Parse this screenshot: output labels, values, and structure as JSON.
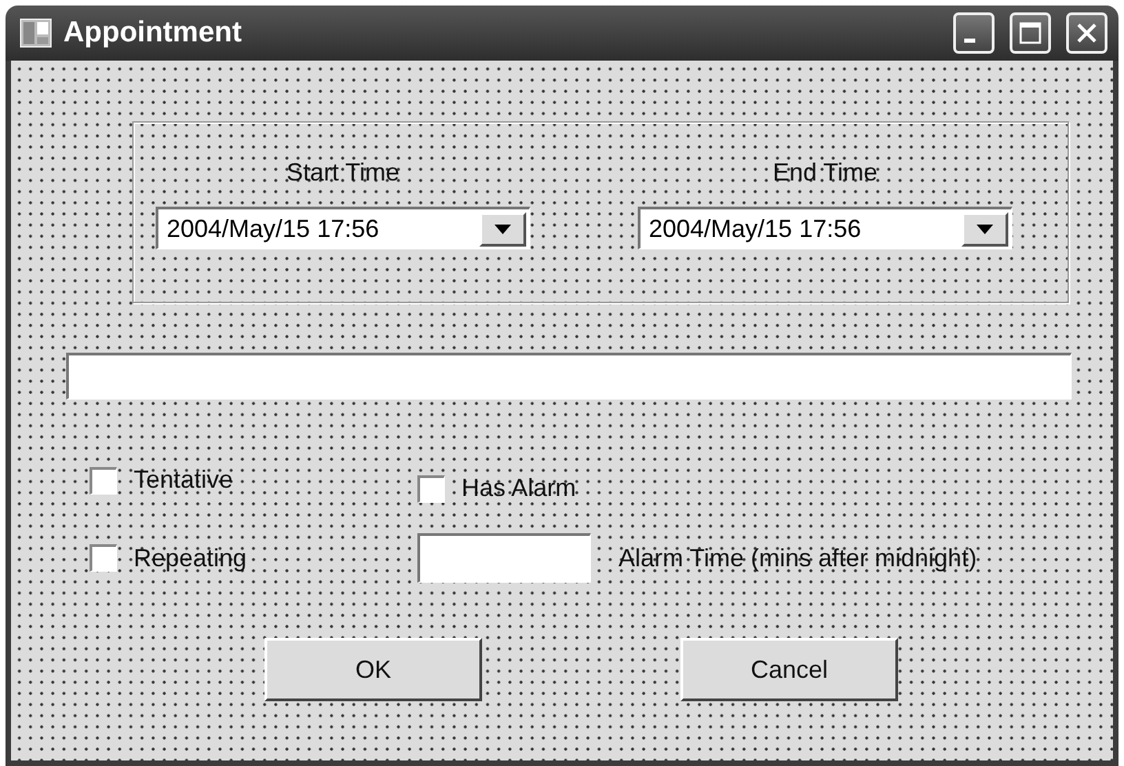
{
  "window": {
    "title": "Appointment"
  },
  "time_group": [
    {
      "label": "Start Time",
      "value": "2004/May/15 17:56"
    },
    {
      "label": "End Time",
      "value": "2004/May/15 17:56"
    }
  ],
  "checkboxes": [
    {
      "label": "Tentative",
      "checked": false
    },
    {
      "label": "Has Alarm",
      "checked": false
    },
    {
      "label": "Repeating",
      "checked": false
    }
  ],
  "alarm_time": {
    "label": "Alarm Time (mins after midnight)"
  },
  "buttons": [
    "OK",
    "Cancel"
  ]
}
